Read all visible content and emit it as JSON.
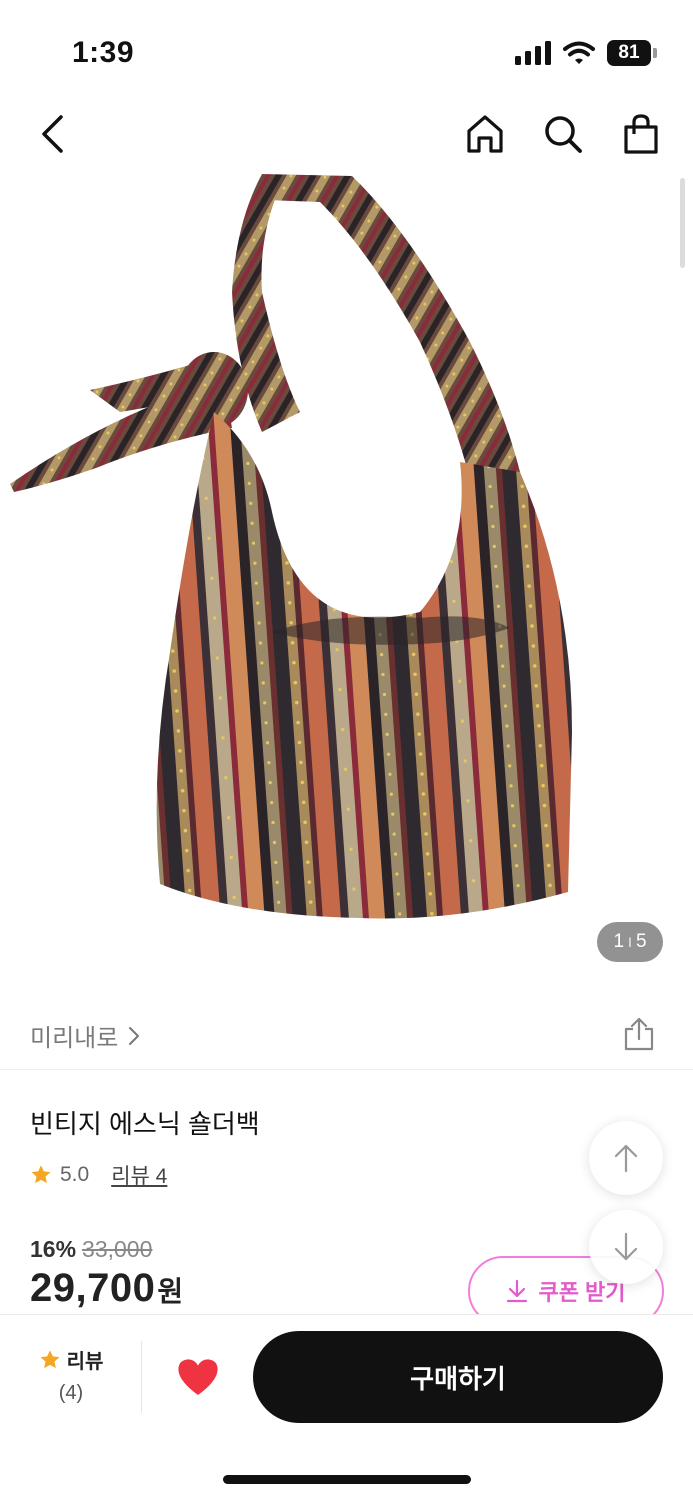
{
  "status_bar": {
    "time": "1:39",
    "battery": "81"
  },
  "colors": {
    "accent_pink": "#f27ed9",
    "star": "#f5a623",
    "heart": "#ef3340",
    "buy_bg": "#111111"
  },
  "product": {
    "image_counter": {
      "current": "1",
      "separator": "I",
      "total": "5"
    },
    "seller": "미리내로",
    "title": "빈티지 에스닉 숄더백",
    "rating": "5.0",
    "review_link": "리뷰 4",
    "discount_rate": "16%",
    "original_price": "33,000",
    "sale_price": "29,700",
    "currency": "원"
  },
  "coupon": {
    "label": "쿠폰 받기"
  },
  "bottom_bar": {
    "review_label": "리뷰",
    "review_count": "(4)",
    "buy_label": "구매하기"
  },
  "icons": [
    "chevron-left-icon",
    "home-icon",
    "search-icon",
    "shopping-bag-icon",
    "share-icon",
    "arrow-up-icon",
    "arrow-down-icon",
    "download-icon",
    "star-icon",
    "heart-icon"
  ]
}
